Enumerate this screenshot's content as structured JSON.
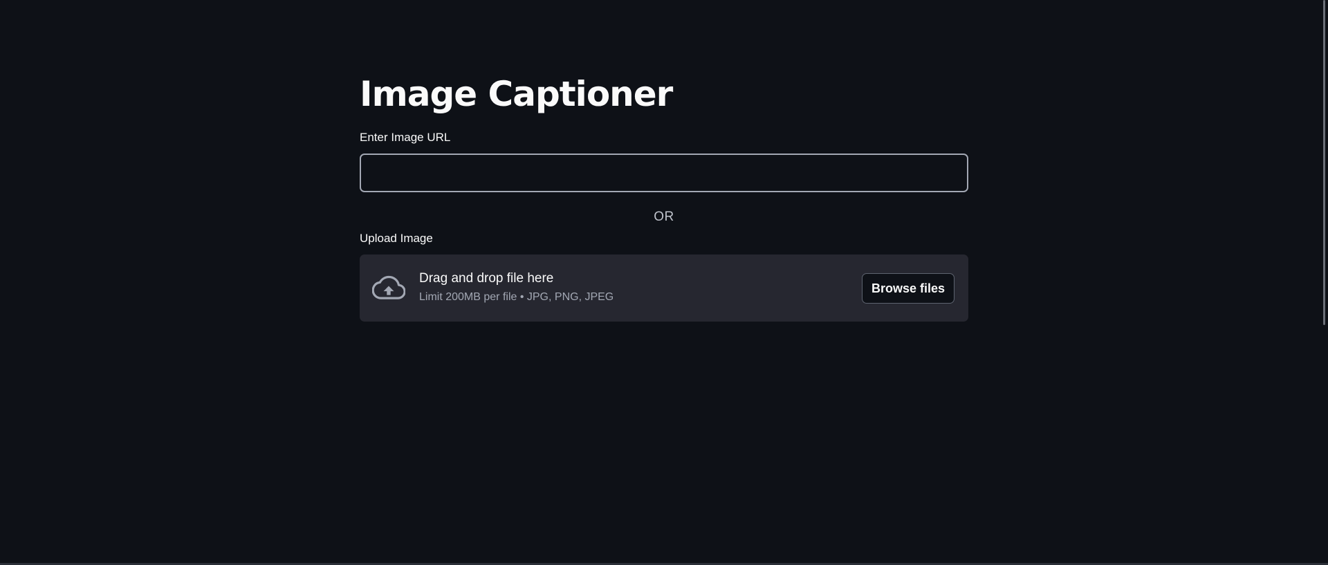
{
  "app": {
    "title": "Image Captioner"
  },
  "url_input": {
    "label": "Enter Image URL",
    "value": "",
    "placeholder": ""
  },
  "separator": {
    "text": "OR"
  },
  "uploader": {
    "label": "Upload Image",
    "drop_text": "Drag and drop file here",
    "limit_text": "Limit 200MB per file • JPG, PNG, JPEG",
    "browse_label": "Browse files",
    "icon": "cloud-upload-icon"
  },
  "colors": {
    "background": "#0e1117",
    "dropzone": "#262730",
    "text": "#fafafa",
    "muted": "#a3a8b4"
  }
}
